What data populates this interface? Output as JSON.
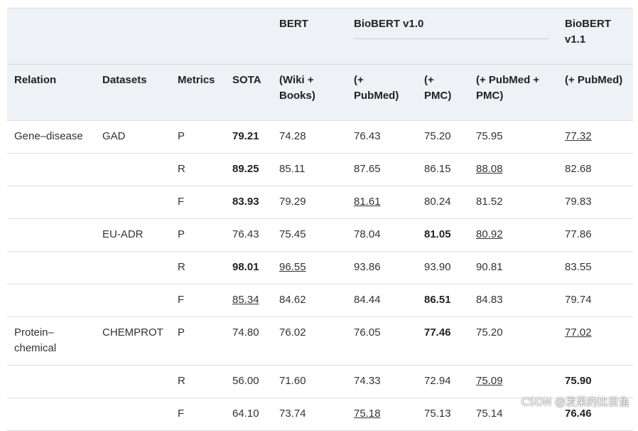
{
  "header": {
    "top": [
      "",
      "",
      "",
      "",
      "BERT",
      "BioBERT v1.0",
      "BioBERT v1.1"
    ],
    "bottom": [
      "Relation",
      "Datasets",
      "Metrics",
      "SOTA",
      "(Wiki + Books)",
      "(+ PubMed)",
      "(+ PMC)",
      "(+ PubMed + PMC)",
      "(+ PubMed)"
    ]
  },
  "rows": [
    {
      "relation": "Gene–disease",
      "dataset": "GAD",
      "metric": "P",
      "values": [
        "79.21",
        "74.28",
        "76.43",
        "75.20",
        "75.95",
        "77.32"
      ],
      "bold": [
        0
      ],
      "underline": [
        5
      ]
    },
    {
      "relation": "",
      "dataset": "",
      "metric": "R",
      "values": [
        "89.25",
        "85.11",
        "87.65",
        "86.15",
        "88.08",
        "82.68"
      ],
      "bold": [
        0
      ],
      "underline": [
        4
      ]
    },
    {
      "relation": "",
      "dataset": "",
      "metric": "F",
      "values": [
        "83.93",
        "79.29",
        "81.61",
        "80.24",
        "81.52",
        "79.83"
      ],
      "bold": [
        0
      ],
      "underline": [
        2
      ]
    },
    {
      "relation": "",
      "dataset": "EU-ADR",
      "metric": "P",
      "values": [
        "76.43",
        "75.45",
        "78.04",
        "81.05",
        "80.92",
        "77.86"
      ],
      "bold": [
        3
      ],
      "underline": [
        4
      ]
    },
    {
      "relation": "",
      "dataset": "",
      "metric": "R",
      "values": [
        "98.01",
        "96.55",
        "93.86",
        "93.90",
        "90.81",
        "83.55"
      ],
      "bold": [
        0
      ],
      "underline": [
        1
      ]
    },
    {
      "relation": "",
      "dataset": "",
      "metric": "F",
      "values": [
        "85.34",
        "84.62",
        "84.44",
        "86.51",
        "84.83",
        "79.74"
      ],
      "bold": [
        3
      ],
      "underline": [
        0
      ]
    },
    {
      "relation": "Protein–chemical",
      "dataset": "CHEMPROT",
      "metric": "P",
      "values": [
        "74.80",
        "76.02",
        "76.05",
        "77.46",
        "75.20",
        "77.02"
      ],
      "bold": [
        3
      ],
      "underline": [
        5
      ],
      "tall": true
    },
    {
      "relation": "",
      "dataset": "",
      "metric": "R",
      "values": [
        "56.00",
        "71.60",
        "74.33",
        "72.94",
        "75.09",
        "75.90"
      ],
      "bold": [
        5
      ],
      "underline": [
        4
      ]
    },
    {
      "relation": "",
      "dataset": "",
      "metric": "F",
      "values": [
        "64.10",
        "73.74",
        "75.18",
        "75.13",
        "75.14",
        "76.46"
      ],
      "bold": [
        5
      ],
      "underline": [
        2
      ]
    }
  ],
  "watermark": "CSDN @发呆的比目鱼"
}
